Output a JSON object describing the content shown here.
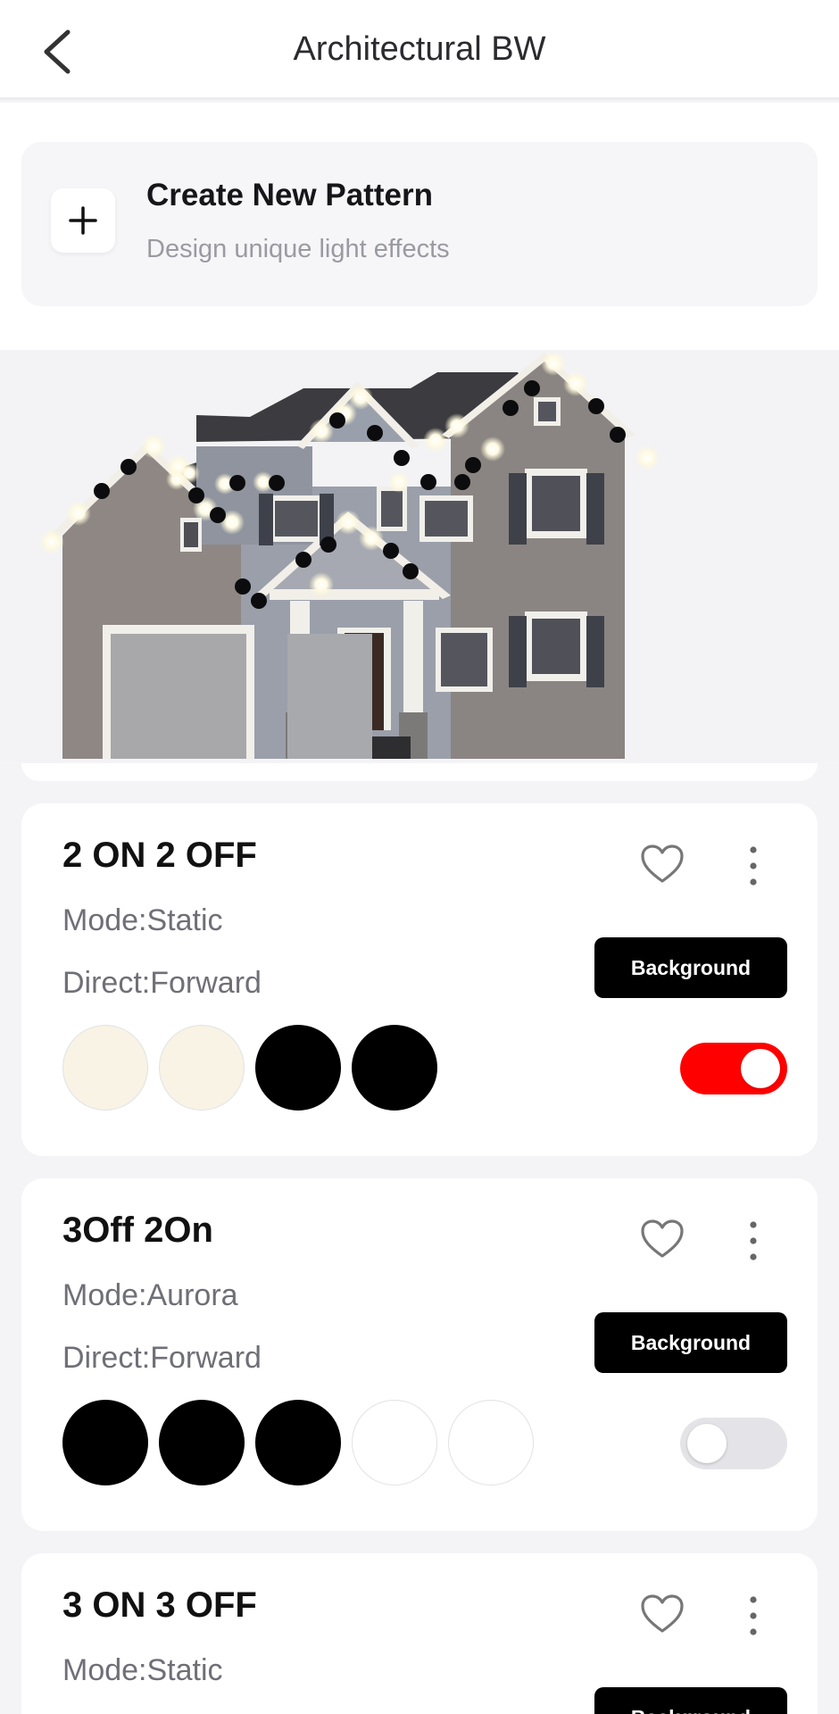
{
  "header": {
    "title": "Architectural BW"
  },
  "create": {
    "title": "Create New Pattern",
    "subtitle": "Design unique light effects"
  },
  "colors": {
    "accent_red": "#ff0000",
    "warm_white": "#f8f3e5",
    "black": "#000000",
    "white": "#ffffff"
  },
  "patterns": [
    {
      "name": "2 ON 2 OFF",
      "mode": "Mode:Static",
      "direct": "Direct:Forward",
      "button_label": "Background",
      "enabled": true,
      "swatches": [
        "#f8f3e5",
        "#f8f3e5",
        "#000000",
        "#000000"
      ]
    },
    {
      "name": "3Off 2On",
      "mode": "Mode:Aurora",
      "direct": "Direct:Forward",
      "button_label": "Background",
      "enabled": false,
      "swatches": [
        "#000000",
        "#000000",
        "#000000",
        "#ffffff",
        "#ffffff"
      ]
    },
    {
      "name": "3 ON 3 OFF",
      "mode": "Mode:Static",
      "direct": "",
      "button_label": "Background",
      "enabled": false,
      "swatches": []
    }
  ]
}
